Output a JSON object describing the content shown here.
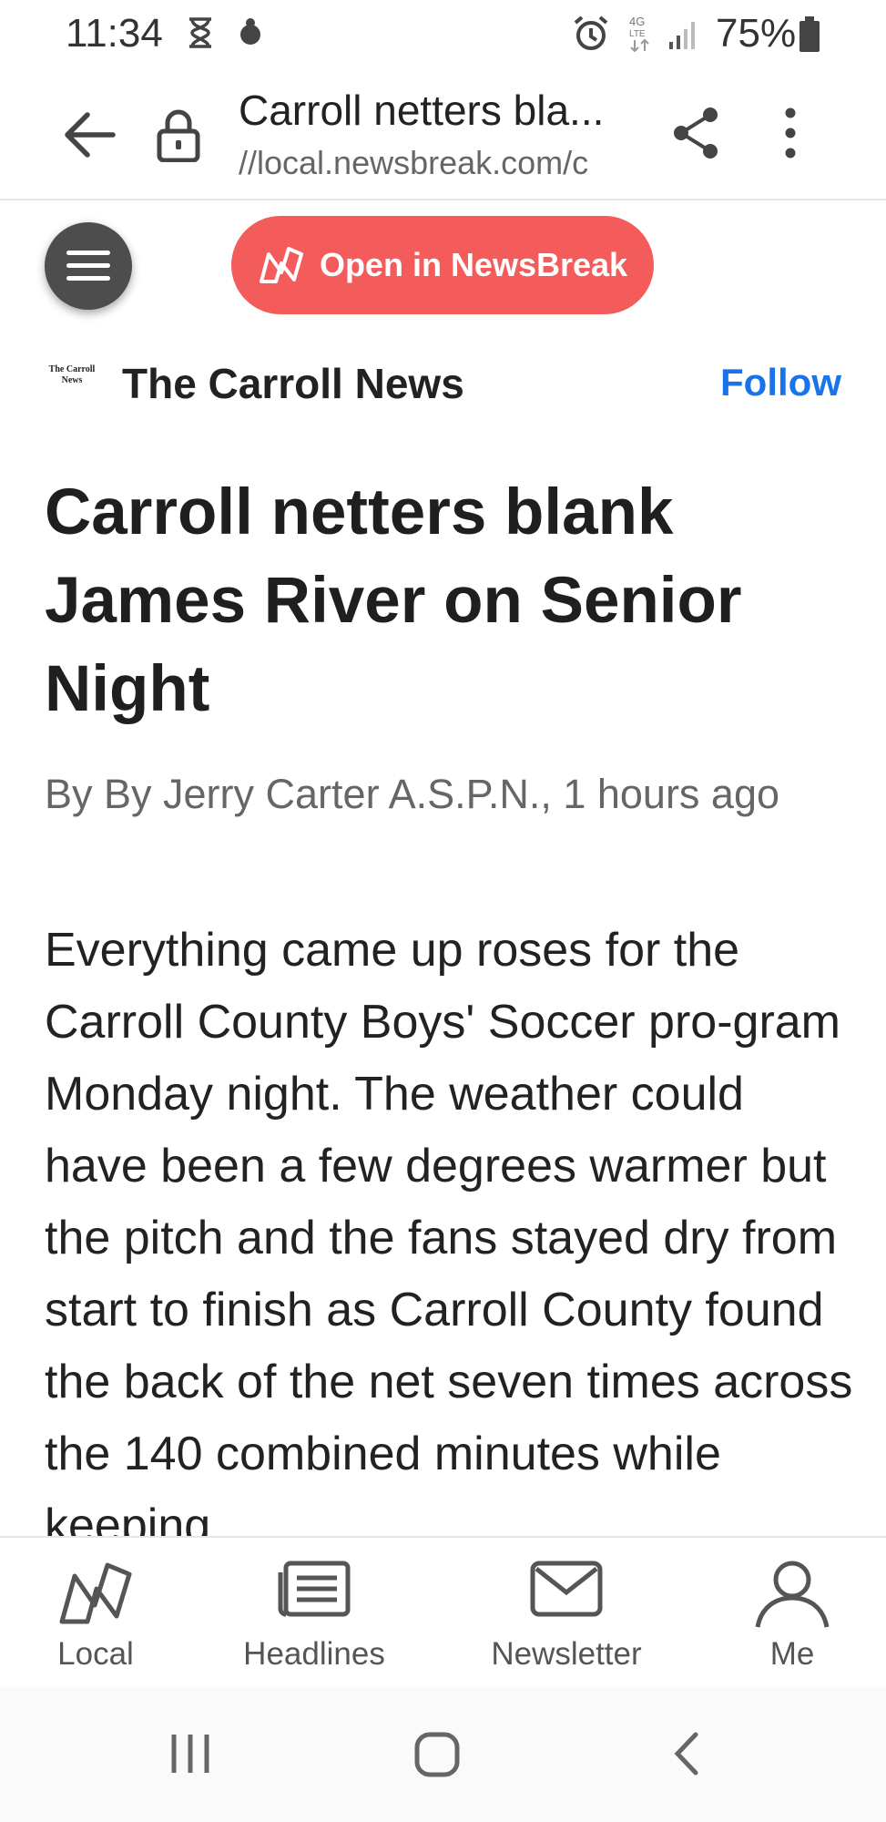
{
  "status_bar": {
    "time": "11:34",
    "battery": "75%",
    "icons": [
      "hourglass-icon",
      "app-notification-icon",
      "alarm-icon",
      "4g-lte-icon",
      "signal-icon",
      "battery-icon"
    ]
  },
  "browser": {
    "page_title": "Carroll netters bla...",
    "url": "//local.newsbreak.com/c"
  },
  "open_button": {
    "label": "Open in NewsBreak",
    "color": "#f45b5b"
  },
  "publisher": {
    "logo_text": "The Carroll News",
    "name": "The Carroll News",
    "follow_label": "Follow",
    "accent": "#1a73e8"
  },
  "article": {
    "headline": "Carroll netters blank James River on Senior Night",
    "byline": "By By Jerry Carter A.S.P.N., 1 hours ago",
    "body": "Everything came up roses for the Carroll County Boys' Soccer pro-gram Monday night. The weather could have been a few degrees warmer but the pitch and the fans stayed dry from start to finish as Carroll County found the back of the net seven times across the 140 combined minutes while keeping"
  },
  "bottom_nav": {
    "items": [
      {
        "label": "Local",
        "icon": "newsbreak-logo-icon"
      },
      {
        "label": "Headlines",
        "icon": "list-icon"
      },
      {
        "label": "Newsletter",
        "icon": "mail-icon"
      },
      {
        "label": "Me",
        "icon": "person-icon"
      }
    ]
  },
  "system_nav": {
    "icons": [
      "recent-apps-icon",
      "home-icon",
      "back-icon"
    ]
  }
}
